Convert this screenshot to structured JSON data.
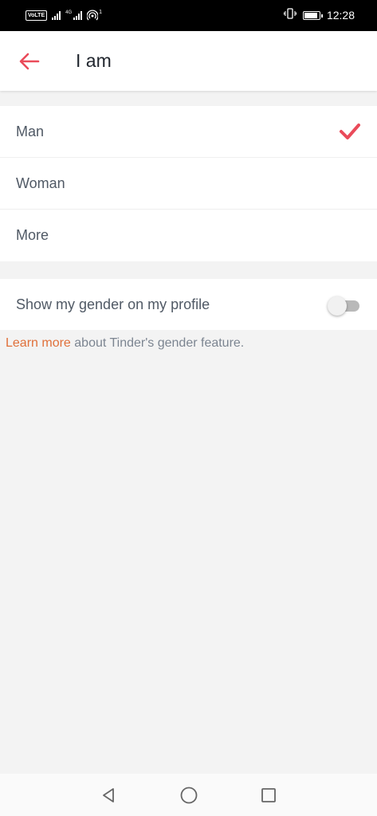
{
  "status_bar": {
    "network_label": "VoLTE",
    "signal_tag_1": "",
    "signal_tag_2": "4G",
    "hotspot_superscript": "1",
    "time": "12:28",
    "battery_level": 0.9
  },
  "header": {
    "back_icon": "arrow-left-icon",
    "title": "I am"
  },
  "options": [
    {
      "label": "Man",
      "selected": true
    },
    {
      "label": "Woman",
      "selected": false
    },
    {
      "label": "More",
      "selected": false
    }
  ],
  "show_gender": {
    "label": "Show my gender on my profile",
    "enabled": false
  },
  "info": {
    "link_text": "Learn more",
    "rest_text": " about Tinder's gender feature."
  },
  "colors": {
    "accent": "#ea4b5a",
    "link": "#e0703a",
    "background": "#f3f3f3"
  },
  "nav": {
    "back_icon": "triangle-back-icon",
    "home_icon": "circle-home-icon",
    "recents_icon": "square-recents-icon"
  }
}
